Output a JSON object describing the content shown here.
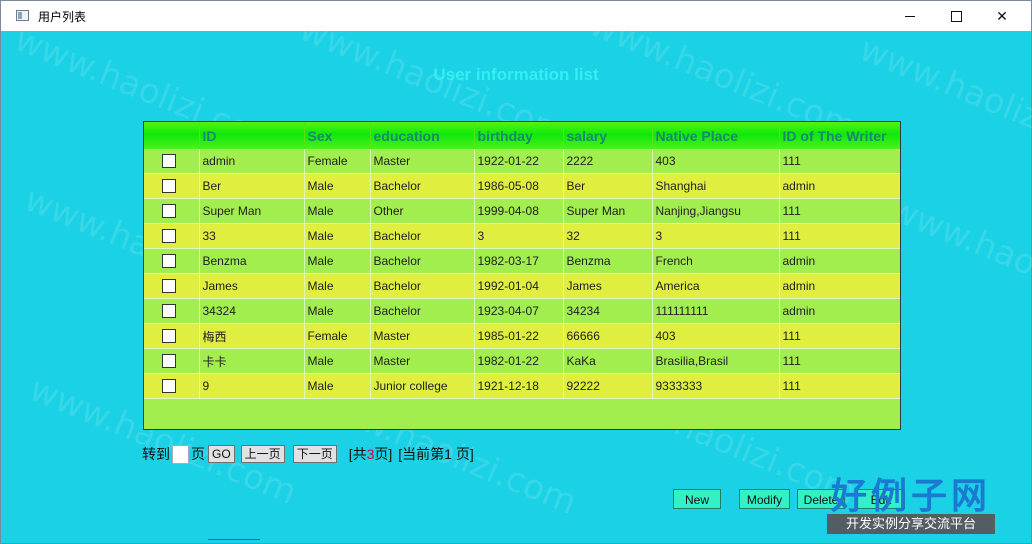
{
  "window": {
    "title": "用户列表"
  },
  "main": {
    "heading": "User information list",
    "table": {
      "columns": [
        "",
        "ID",
        "Sex",
        "education",
        "birthday",
        "salary",
        "Native Place",
        "ID of The Writer"
      ],
      "rows": [
        [
          "admin",
          "Female",
          "Master",
          "1922-01-22",
          "2222",
          "403",
          "111"
        ],
        [
          "Ber",
          "Male",
          "Bachelor",
          "1986-05-08",
          "Ber",
          "Shanghai",
          "admin"
        ],
        [
          "Super Man",
          "Male",
          "Other",
          "1999-04-08",
          "Super Man",
          "Nanjing,Jiangsu",
          "111"
        ],
        [
          "33",
          "Male",
          "Bachelor",
          "3",
          "32",
          "3",
          "111"
        ],
        [
          "Benzma",
          "Male",
          "Bachelor",
          "1982-03-17",
          "Benzma",
          "French",
          "admin"
        ],
        [
          "James",
          "Male",
          "Bachelor",
          "1992-01-04",
          "James",
          "America",
          "admin"
        ],
        [
          "34324",
          "Male",
          "Bachelor",
          "1923-04-07",
          "34234",
          "111111111",
          "admin"
        ],
        [
          "梅西",
          "Female",
          "Master",
          "1985-01-22",
          "66666",
          "403",
          "111"
        ],
        [
          "卡卡",
          "Male",
          "Master",
          "1982-01-22",
          "KaKa",
          "Brasilia,Brasil",
          "111"
        ],
        [
          "9",
          "Male",
          "Junior college",
          "1921-12-18",
          "92222",
          "9333333",
          "111"
        ]
      ]
    },
    "pager": {
      "goto_label": "转到",
      "page_label": "页",
      "go_button": "GO",
      "prev_button": "上一页",
      "next_button": "下一页",
      "total_prefix": "[共",
      "total_pages": "3",
      "total_suffix": "页]",
      "current_prefix": "[当前第",
      "current_page": "1",
      "current_suffix": " 页]"
    },
    "actions": {
      "new": "New",
      "modify": "Modify",
      "delete": "Delete",
      "edit": "Edit"
    }
  },
  "watermark": {
    "text": "www.haolizi.com"
  },
  "logo": {
    "big_text": "好例子网",
    "small_text": "开发实例分享交流平台"
  }
}
